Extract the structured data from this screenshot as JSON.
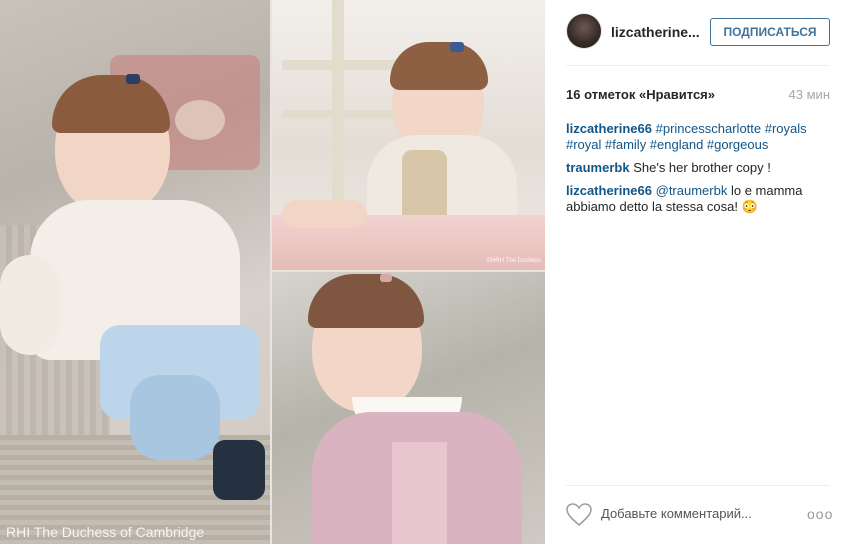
{
  "photo": {
    "watermark": "RHI The Duchess of Cambridge",
    "watermark_small": "©HRH The Duchess"
  },
  "header": {
    "username": "lizcatherine...",
    "follow_label": "ПОДПИСАТЬСЯ"
  },
  "stats": {
    "likes": "16 отметок «Нравится»",
    "time": "43 мин"
  },
  "comments": [
    {
      "user": "lizcatherine66",
      "text": "#princesscharlotte #royals #royal #family #england #gorgeous"
    },
    {
      "user": "traumerbk",
      "text": "She's her brother copy !"
    },
    {
      "user": "lizcatherine66",
      "mention": "@traumerbk",
      "text": "lo e mamma abbiamo detto la stessa cosa! 😳"
    }
  ],
  "comment_box": {
    "placeholder": "Добавьте комментарий...",
    "more": "ooo"
  },
  "colors": {
    "accent": "#3f729b",
    "link": "#125688",
    "muted": "#a5a7aa"
  }
}
